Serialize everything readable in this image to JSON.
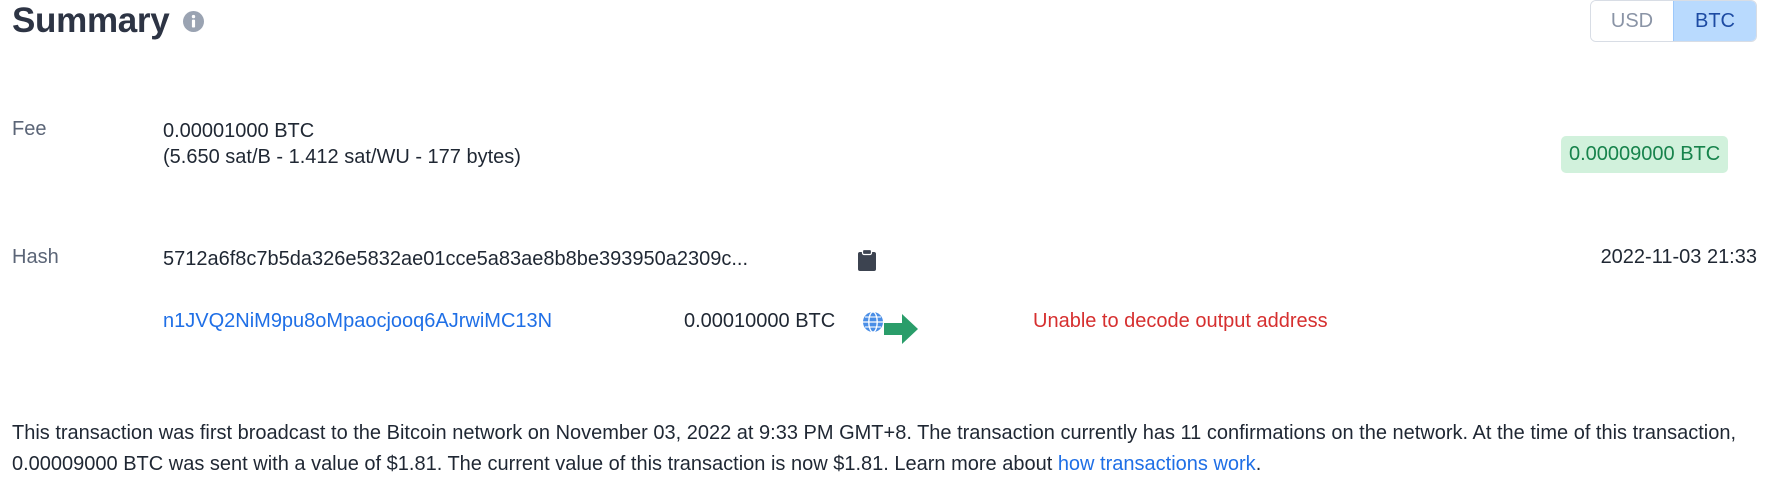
{
  "header": {
    "title": "Summary",
    "info_icon": "info-circle-icon"
  },
  "currency_toggle": {
    "options": [
      "USD",
      "BTC"
    ],
    "selected": "BTC"
  },
  "fee": {
    "label": "Fee",
    "amount": "0.00001000 BTC",
    "detail": "(5.650 sat/B - 1.412 sat/WU - 177 bytes)"
  },
  "total_amount": "0.00009000 BTC",
  "hash": {
    "label": "Hash",
    "value": "5712a6f8c7b5da326e5832ae01cce5a83ae8b8be393950a2309c...",
    "copy_icon": "clipboard-icon",
    "timestamp": "2022-11-03 21:33"
  },
  "output": {
    "address": "n1JVQ2NiM9pu8oMpaocjooq6AJrwiMC13N",
    "amount": "0.00010000 BTC",
    "globe_icon": "globe-icon",
    "arrow_icon": "arrow-right-icon",
    "error": "Unable to decode output address"
  },
  "description": {
    "text": "This transaction was first broadcast to the Bitcoin network on November 03, 2022 at 9:33 PM GMT+8.  The transaction currently has 11 confirmations on the network.  At the time of this transaction, 0.00009000 BTC was sent with a value of $1.81. The current value of this transaction is now $1.81.  Learn more about ",
    "link_text": "how transactions work",
    "suffix": "."
  },
  "colors": {
    "link": "#1f6fe6",
    "positive_badge_bg": "#d1f1dc",
    "positive_badge_text": "#17834c",
    "error": "#d62f2f",
    "toggle_selected_bg": "#b9dafe"
  }
}
